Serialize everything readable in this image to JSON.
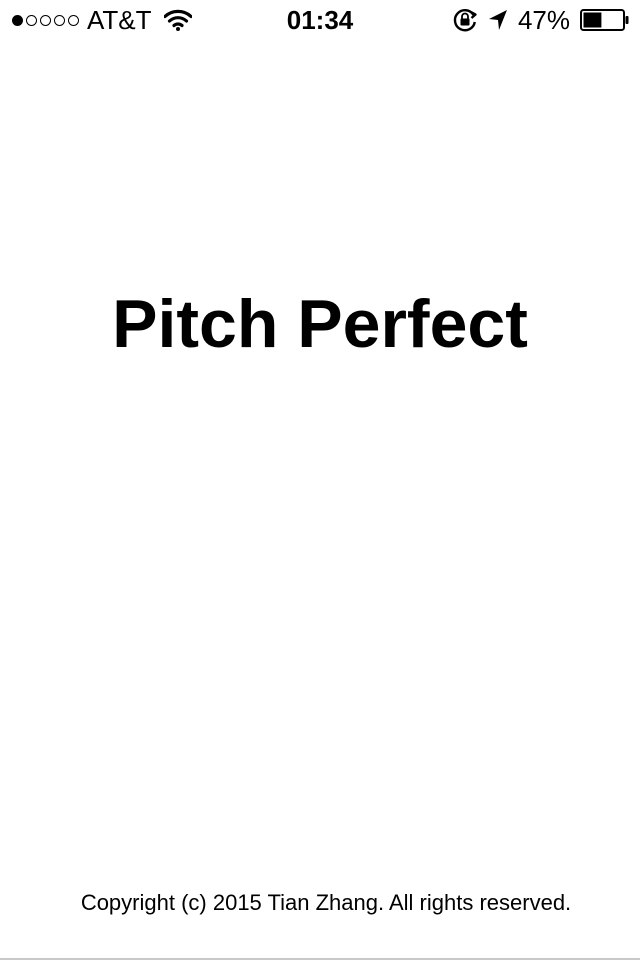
{
  "status_bar": {
    "signal_strength": 1,
    "signal_max": 5,
    "carrier": "AT&T",
    "time": "01:34",
    "battery_percent": "47%",
    "battery_level": 0.47,
    "icons": [
      "wifi-icon",
      "rotation-lock-icon",
      "location-arrow-icon",
      "battery-icon"
    ]
  },
  "main": {
    "title": "Pitch Perfect",
    "copyright": "Copyright (c) 2015 Tian Zhang. All rights reserved."
  },
  "colors": {
    "background": "#ffffff",
    "text": "#000000"
  }
}
